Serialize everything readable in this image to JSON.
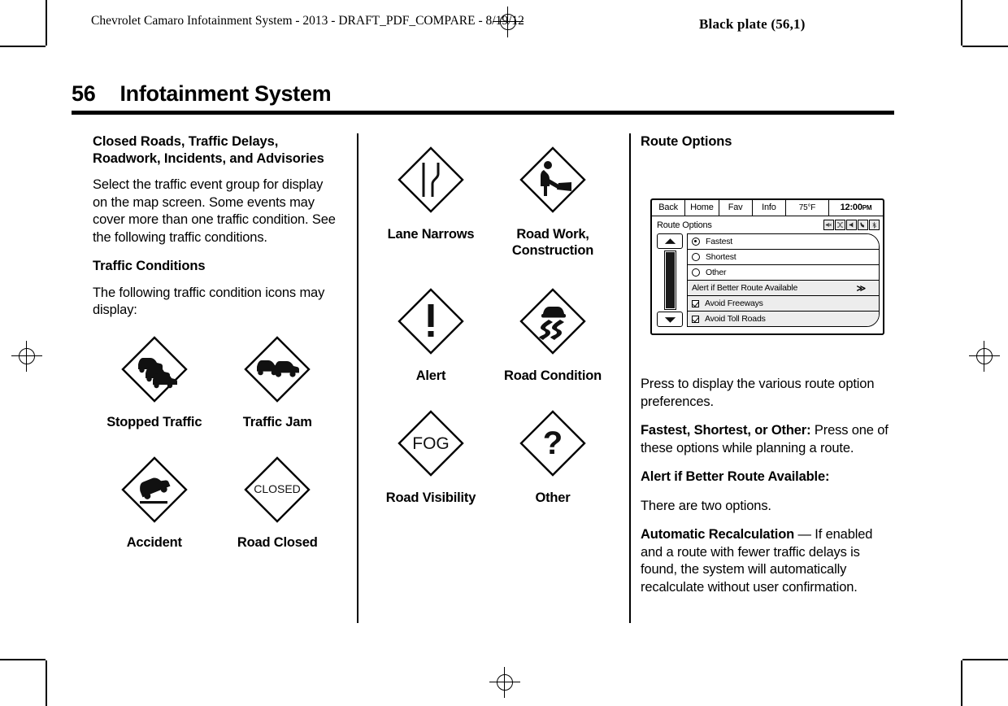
{
  "header": {
    "running_head": "Chevrolet Camaro Infotainment System - 2013 - DRAFT_PDF_COMPARE - 8/19/12",
    "black_plate": "Black plate (56,1)"
  },
  "page": {
    "number": "56",
    "title": "Infotainment System"
  },
  "column1": {
    "heading": "Closed Roads, Traffic Delays, Roadwork, Incidents, and Advisories",
    "para1": "Select the traffic event group for display on the map screen. Some events may cover more than one traffic condition. See the following traffic conditions.",
    "heading2": "Traffic Conditions",
    "para2": "The following traffic condition icons may display:",
    "icons": [
      {
        "caption": "Stopped Traffic",
        "icon": "stopped-traffic-sign-icon"
      },
      {
        "caption": "Traffic Jam",
        "icon": "traffic-jam-sign-icon"
      },
      {
        "caption": "Accident",
        "icon": "accident-sign-icon"
      },
      {
        "caption": "Road Closed",
        "icon": "road-closed-sign-icon",
        "text": "CLOSED"
      }
    ]
  },
  "column2": {
    "icons": [
      {
        "caption": "Lane Narrows",
        "icon": "lane-narrows-sign-icon"
      },
      {
        "caption": "Road Work, Construction",
        "icon": "road-work-sign-icon"
      },
      {
        "caption": "Alert",
        "icon": "alert-sign-icon",
        "text": "!"
      },
      {
        "caption": "Road Condition",
        "icon": "road-condition-slippery-sign-icon"
      },
      {
        "caption": "Road Visibility",
        "icon": "road-visibility-fog-sign-icon",
        "text": "FOG"
      },
      {
        "caption": "Other",
        "icon": "other-sign-icon",
        "text": "?"
      }
    ]
  },
  "column3": {
    "heading": "Route Options",
    "screen": {
      "tabs": [
        "Back",
        "Home",
        "Fav",
        "Info"
      ],
      "temperature": "75°F",
      "clock_time": "12:00",
      "clock_ampm": "PM",
      "title": "Route Options",
      "status_icons": [
        "mute-icon",
        "shuffle-icon",
        "speaker-icon",
        "phone-icon",
        "bluetooth-icon"
      ],
      "scroll_up": "scroll-up-arrow-icon",
      "scroll_down": "scroll-down-arrow-icon",
      "rows": [
        {
          "label": "Fastest",
          "control": "radio",
          "selected": true
        },
        {
          "label": "Shortest",
          "control": "radio",
          "selected": false
        },
        {
          "label": "Other",
          "control": "radio",
          "selected": false
        },
        {
          "label": "Alert if Better Route Available",
          "control": "arrow",
          "arrow": "≫"
        },
        {
          "label": "Avoid Freeways",
          "control": "checkbox",
          "checked": true
        },
        {
          "label": "Avoid Toll Roads",
          "control": "checkbox",
          "checked": true
        }
      ]
    },
    "para1": "Press to display the various route option preferences.",
    "term1": "Fastest, Shortest, or Other:",
    "term1_body": " Press one of these options while planning a route.",
    "term2": "Alert if Better Route Available:",
    "para2": "There are two options.",
    "term3": "Automatic Recalculation",
    "term3_body": " — If enabled and a route with fewer traffic delays is found, the system will automatically recalculate without user confirmation."
  }
}
